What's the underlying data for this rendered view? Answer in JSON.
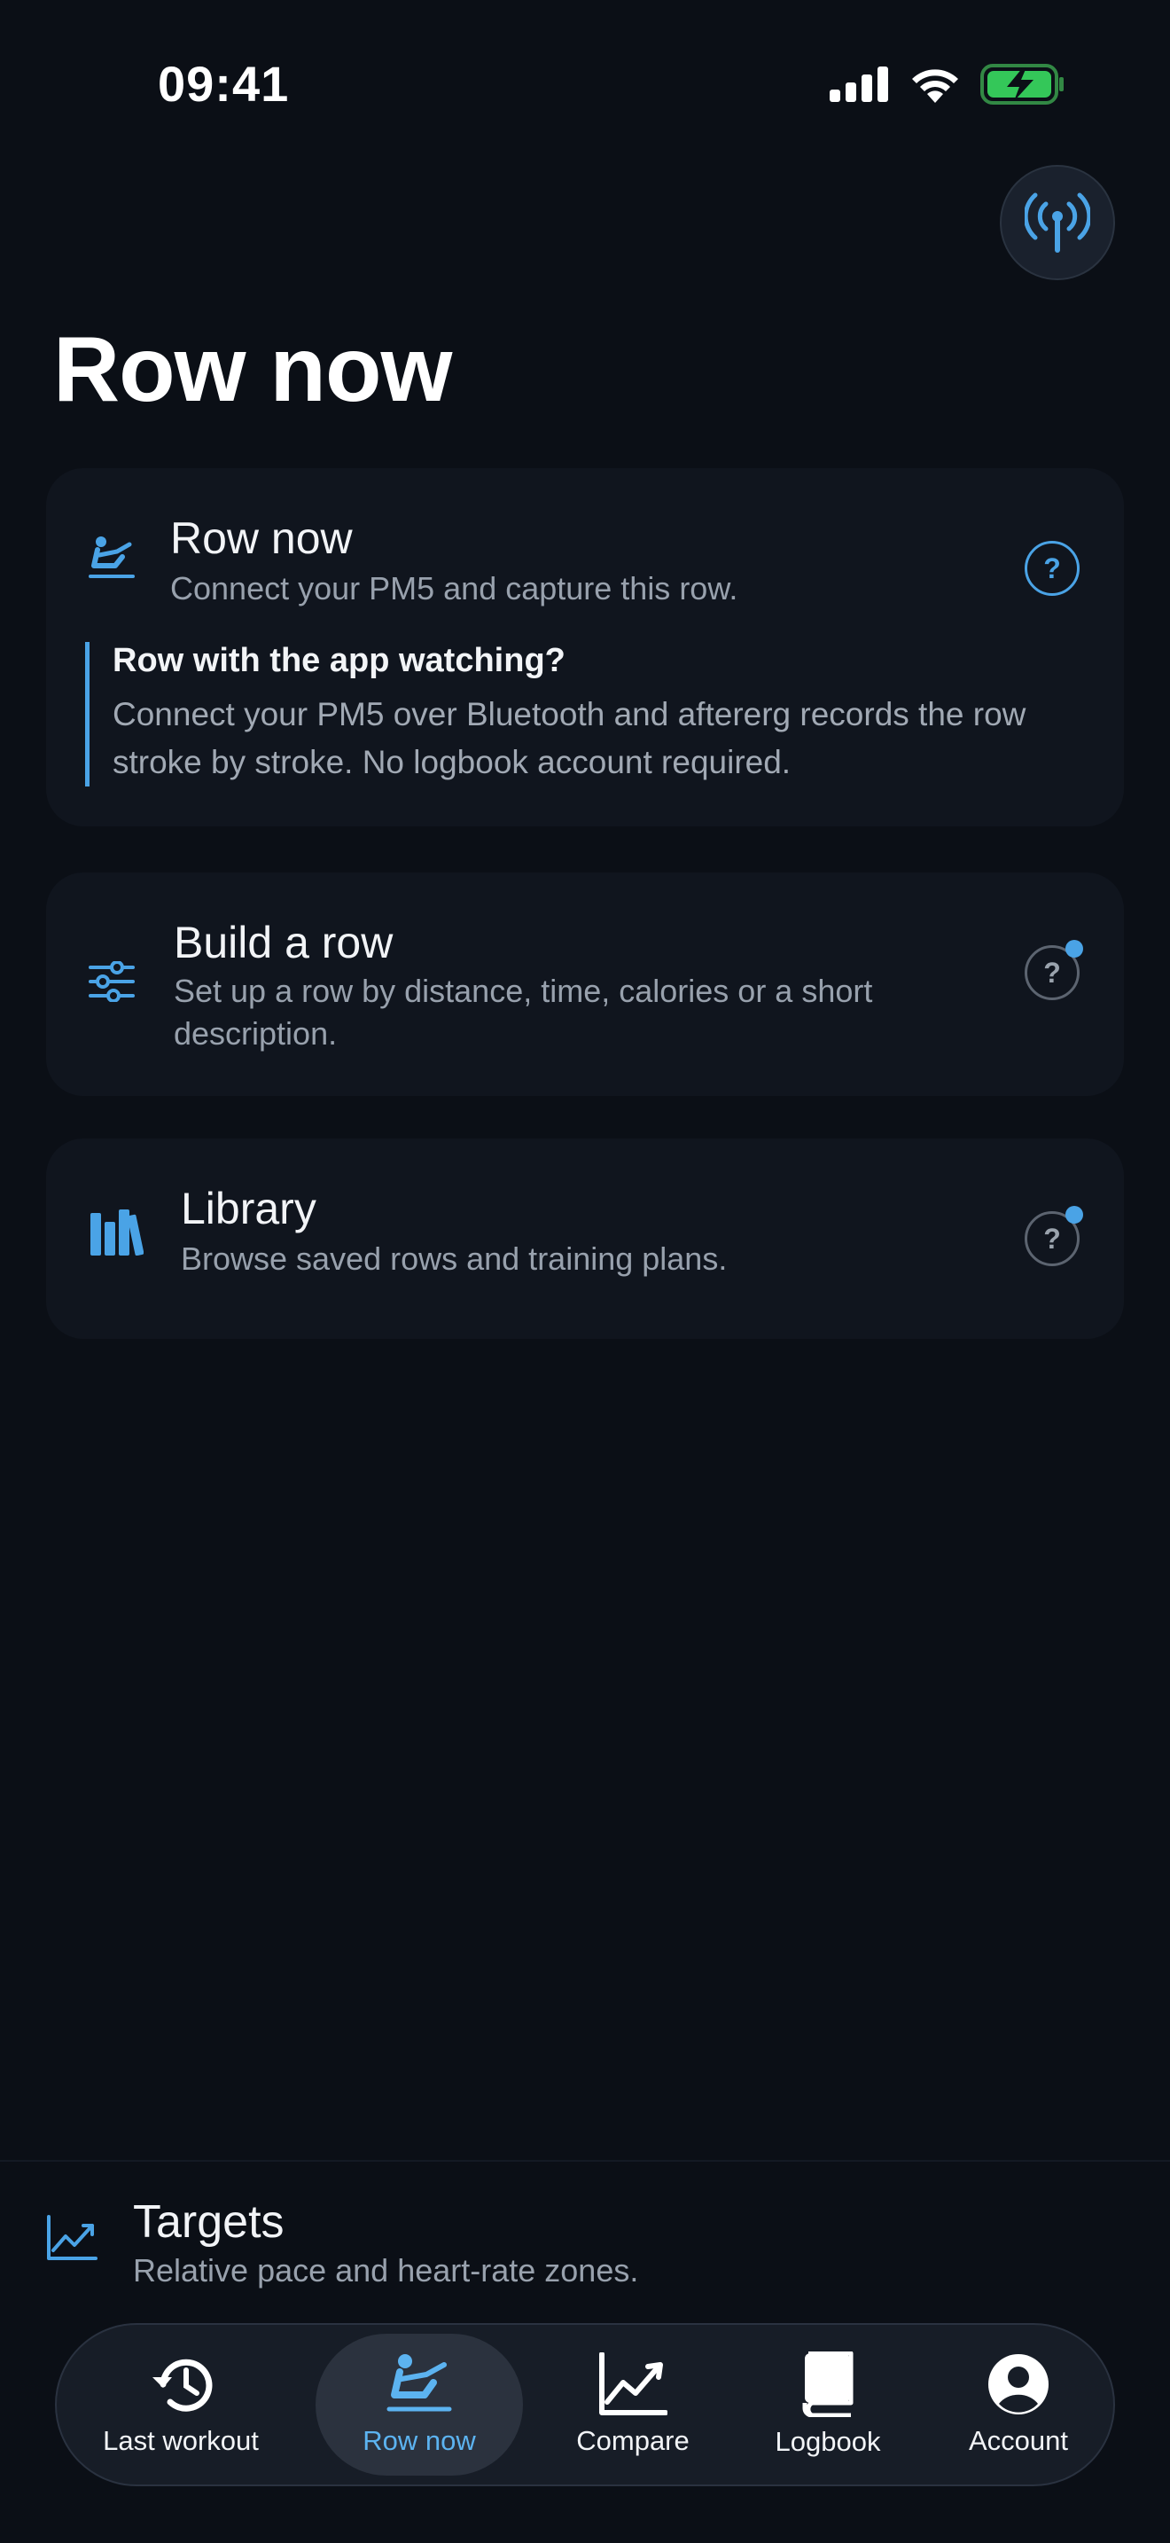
{
  "status_bar": {
    "time": "09:41"
  },
  "page_title": "Row now",
  "cards": {
    "row_now": {
      "title": "Row now",
      "subtitle": "Connect your PM5 and capture this row.",
      "help": "?",
      "callout_title": "Row with the app watching?",
      "callout_body": "Connect your PM5 over Bluetooth and aftererg records the row stroke by stroke. No logbook account required."
    },
    "build": {
      "title": "Build a row",
      "subtitle": "Set up a row by distance, time, calories or a short description.",
      "help": "?"
    },
    "library": {
      "title": "Library",
      "subtitle": "Browse saved rows and training plans.",
      "help": "?"
    }
  },
  "targets": {
    "title": "Targets",
    "subtitle": "Relative pace and heart-rate zones."
  },
  "tabs": [
    {
      "label": "Last workout",
      "icon": "history-icon"
    },
    {
      "label": "Row now",
      "icon": "rower-icon",
      "active": true
    },
    {
      "label": "Compare",
      "icon": "chart-icon"
    },
    {
      "label": "Logbook",
      "icon": "book-icon"
    },
    {
      "label": "Account",
      "icon": "account-icon"
    }
  ],
  "colors": {
    "accent": "#4aa3e6",
    "background": "#0b0f16",
    "card": "#10151e"
  }
}
